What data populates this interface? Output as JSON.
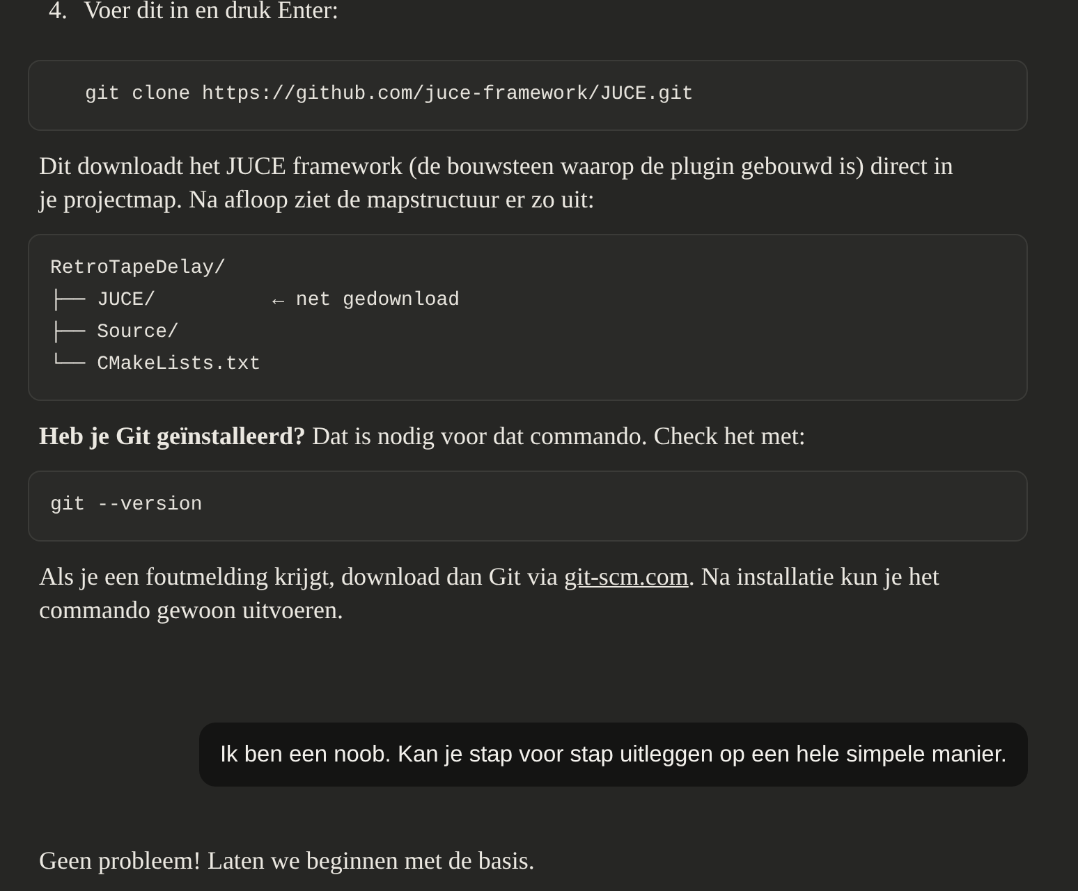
{
  "messages": [
    {
      "kind": "assistant",
      "blocks": [
        {
          "kind": "list_item",
          "number": "4.",
          "text": "Voer dit in en druk Enter:"
        },
        {
          "kind": "code",
          "indented": true,
          "lines": [
            "git clone https://github.com/juce-framework/JUCE.git"
          ]
        },
        {
          "kind": "paragraph",
          "parts": [
            {
              "kind": "text",
              "text": "Dit downloadt het JUCE framework (de bouwsteen waarop de plugin gebouwd is) direct in je projectmap. Na afloop ziet de mapstructuur er zo uit:"
            }
          ]
        },
        {
          "kind": "code",
          "indented": false,
          "lines": [
            "RetroTapeDelay/",
            "├── JUCE/          ← net gedownload",
            "├── Source/",
            "└── CMakeLists.txt"
          ]
        },
        {
          "kind": "paragraph",
          "parts": [
            {
              "kind": "text",
              "text": "**Heb je Git geïnstalleerd?** Dat is nodig voor dat commando. Check het met:"
            }
          ]
        },
        {
          "kind": "code",
          "indented": false,
          "lines": [
            "git --version"
          ]
        },
        {
          "kind": "paragraph",
          "parts": [
            {
              "kind": "text",
              "text": "Als je een foutmelding krijgt, download dan Git via "
            },
            {
              "kind": "link",
              "text": "git-scm.com"
            },
            {
              "kind": "text",
              "text": ". Na installatie kun je het commando gewoon uitvoeren."
            }
          ]
        }
      ]
    },
    {
      "kind": "user",
      "text": "Ik ben een noob. Kan je stap voor stap uitleggen op een hele simpele manier."
    },
    {
      "kind": "assistant",
      "blocks": [
        {
          "kind": "paragraph",
          "parts": [
            {
              "kind": "text",
              "text": "Geen probleem! Laten we beginnen met de basis."
            }
          ]
        }
      ]
    }
  ]
}
